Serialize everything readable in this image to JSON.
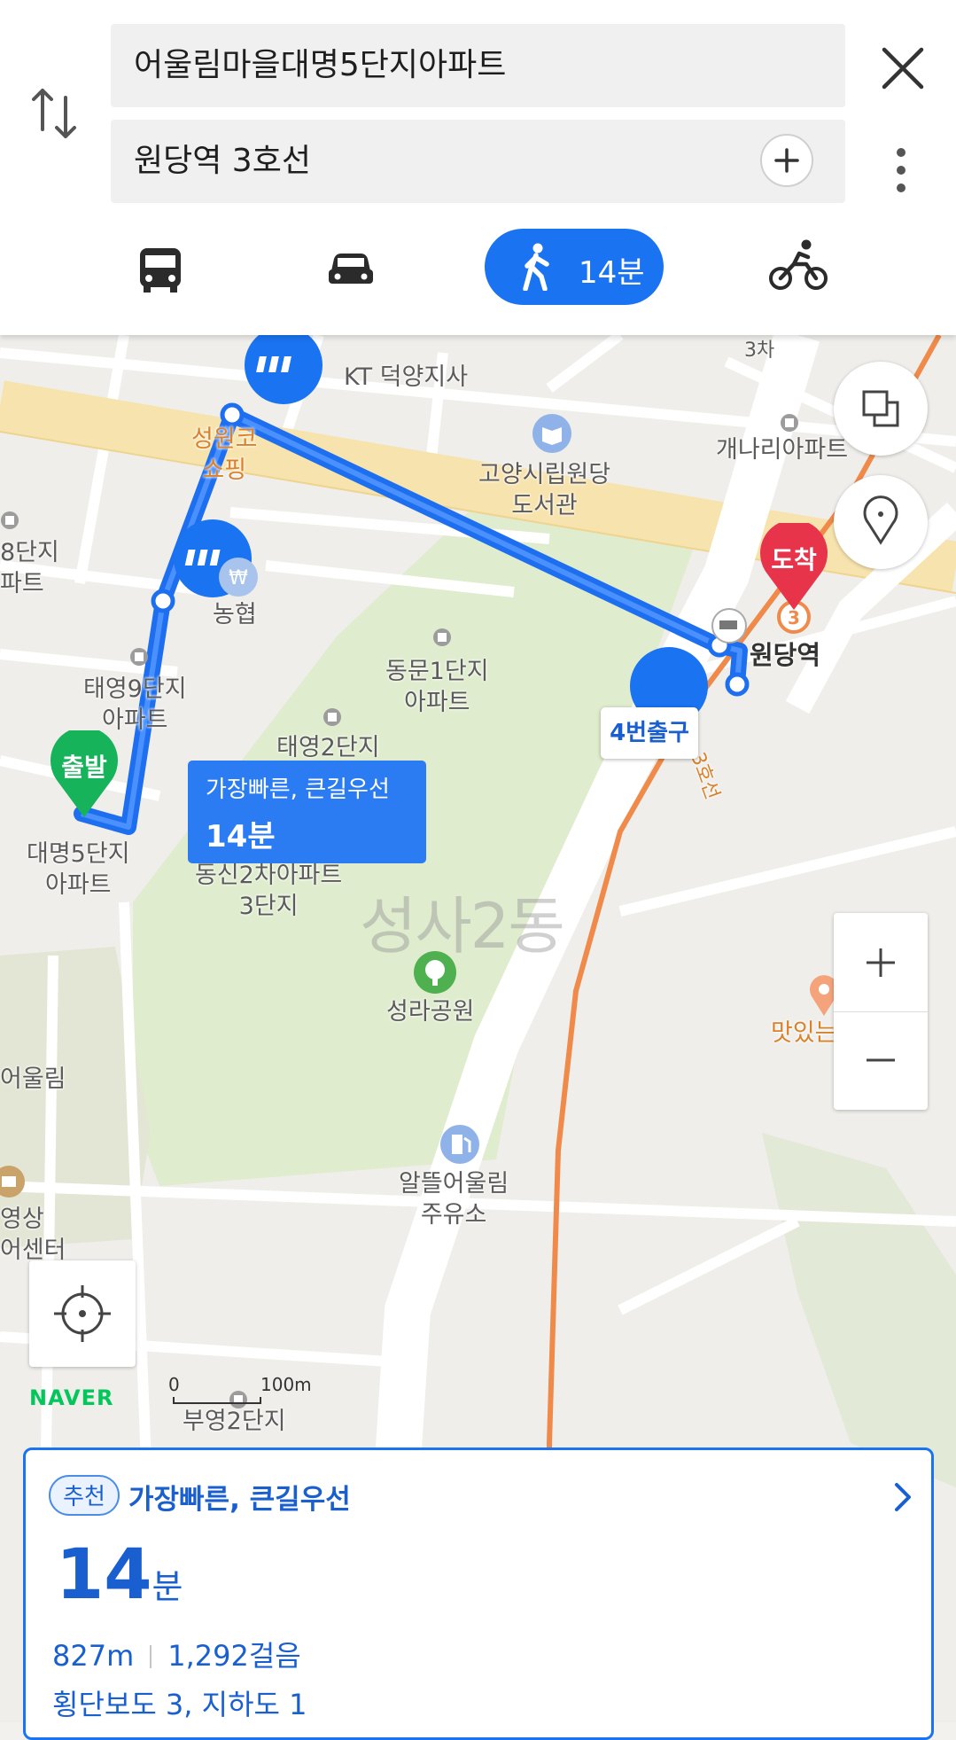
{
  "search": {
    "origin": "어울림마을대명5단지아파트",
    "destination": "원당역 3호선"
  },
  "modes": [
    {
      "name": "bus",
      "icon": "bus-icon"
    },
    {
      "name": "car",
      "icon": "car-icon"
    },
    {
      "name": "walk",
      "icon": "walk-icon",
      "time": "14분",
      "selected": true
    },
    {
      "name": "bike",
      "icon": "bike-icon"
    }
  ],
  "map": {
    "labels": {
      "kt": "KT 덕양지사",
      "seongwon": "성원코\n쇼핑",
      "library": "고양시립원당\n도서관",
      "gaenari": "개나리아파트",
      "danji8": "8단지\n파트",
      "nonghyup": "농협",
      "dongmun": "동문1단지\n아파트",
      "taeyoung9": "태영9단지\n아파트",
      "taeyoung2": "태영2단지\n아파트",
      "daemyung5": "대명5단지\n아파트",
      "dongsin2": "동신2차아파트\n3단지",
      "district": "성사2동",
      "seongra": "성라공원",
      "eoullim": "어울림",
      "video": "영상\n어센터",
      "gas": "알뜰어울림\n주유소",
      "tasty": "맛있는",
      "buyoung2": "부영2단지",
      "wondang_station": "원당역",
      "line3": "3호선",
      "samchi": "3차"
    },
    "start_flag": "출발",
    "end_flag": "도착",
    "exit_label": "4번출구",
    "callout": {
      "route": "가장빠른, 큰길우선",
      "time": "14분"
    },
    "scale": {
      "zero": "0",
      "length": "100m"
    },
    "logo": "NAVER"
  },
  "route_card": {
    "badge": "추천",
    "name": "가장빠른, 큰길우선",
    "time_value": "14",
    "time_unit": "분",
    "distance": "827m",
    "steps": "1,292걸음",
    "crossings": "횡단보도 3, 지하도 1"
  },
  "colors": {
    "accent": "#1a73f0",
    "route": "#1e6ff0",
    "start": "#16b35a",
    "end": "#e8344a",
    "subway_line3": "#f08a4b"
  }
}
